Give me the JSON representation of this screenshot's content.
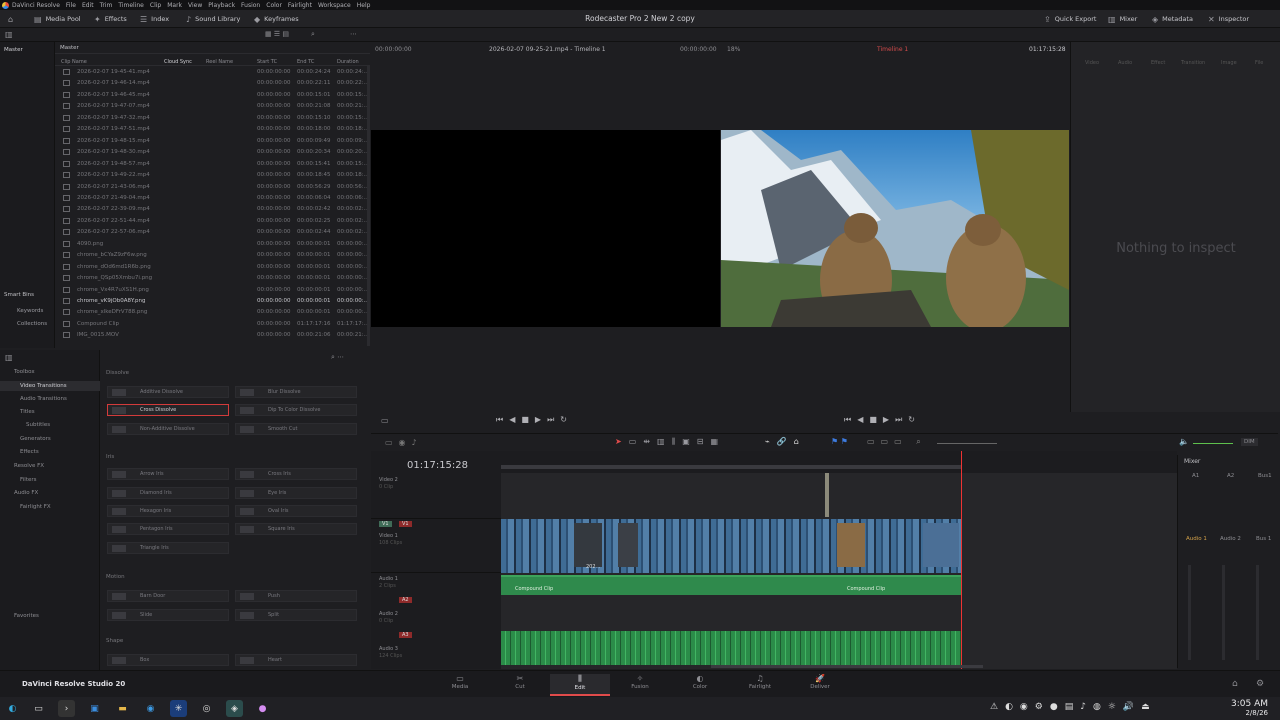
{
  "menu": [
    "DaVinci Resolve",
    "File",
    "Edit",
    "Trim",
    "Timeline",
    "Clip",
    "Mark",
    "View",
    "Playback",
    "Fusion",
    "Color",
    "Fairlight",
    "Workspace",
    "Help"
  ],
  "toolbar": {
    "media_pool": "Media Pool",
    "effects": "Effects",
    "index": "Index",
    "sound_library": "Sound Library",
    "keyframes": "Keyframes",
    "project_title": "Rodecaster Pro 2 New 2 copy",
    "quick_export": "Quick Export",
    "mixer": "Mixer",
    "metadata": "Metadata",
    "inspector": "Inspector"
  },
  "bins": {
    "master": "Master",
    "smart_bins": "Smart Bins",
    "keywords": "Keywords",
    "collections": "Collections"
  },
  "pool": {
    "header": "Master",
    "columns": [
      "Clip Name",
      "Cloud Sync",
      "Reel Name",
      "Start TC",
      "End TC",
      "Duration"
    ],
    "rows": [
      {
        "name": "2026-02-07 19-45-41.mp4",
        "start": "00:00:00:00",
        "end": "00:00:24:24",
        "dur": "00:00:24:..."
      },
      {
        "name": "2026-02-07 19-46-14.mp4",
        "start": "00:00:00:00",
        "end": "00:00:22:11",
        "dur": "00:00:22:..."
      },
      {
        "name": "2026-02-07 19-46-45.mp4",
        "start": "00:00:00:00",
        "end": "00:00:15:01",
        "dur": "00:00:15:..."
      },
      {
        "name": "2026-02-07 19-47-07.mp4",
        "start": "00:00:00:00",
        "end": "00:00:21:08",
        "dur": "00:00:21:..."
      },
      {
        "name": "2026-02-07 19-47-32.mp4",
        "start": "00:00:00:00",
        "end": "00:00:15:10",
        "dur": "00:00:15:..."
      },
      {
        "name": "2026-02-07 19-47-51.mp4",
        "start": "00:00:00:00",
        "end": "00:00:18:00",
        "dur": "00:00:18:..."
      },
      {
        "name": "2026-02-07 19-48-15.mp4",
        "start": "00:00:00:00",
        "end": "00:00:09:49",
        "dur": "00:00:09:..."
      },
      {
        "name": "2026-02-07 19-48-30.mp4",
        "start": "00:00:00:00",
        "end": "00:00:20:34",
        "dur": "00:00:20:..."
      },
      {
        "name": "2026-02-07 19-48-57.mp4",
        "start": "00:00:00:00",
        "end": "00:00:15:41",
        "dur": "00:00:15:..."
      },
      {
        "name": "2026-02-07 19-49-22.mp4",
        "start": "00:00:00:00",
        "end": "00:00:18:45",
        "dur": "00:00:18:..."
      },
      {
        "name": "2026-02-07 21-43-06.mp4",
        "start": "00:00:00:00",
        "end": "00:00:56:29",
        "dur": "00:00:56:..."
      },
      {
        "name": "2026-02-07 21-49-04.mp4",
        "start": "00:00:00:00",
        "end": "00:00:06:04",
        "dur": "00:00:06:..."
      },
      {
        "name": "2026-02-07 22-39-09.mp4",
        "start": "00:00:00:00",
        "end": "00:00:02:42",
        "dur": "00:00:02:..."
      },
      {
        "name": "2026-02-07 22-51-44.mp4",
        "start": "00:00:00:00",
        "end": "00:00:02:25",
        "dur": "00:00:02:..."
      },
      {
        "name": "2026-02-07 22-57-06.mp4",
        "start": "00:00:00:00",
        "end": "00:00:02:44",
        "dur": "00:00:02:..."
      },
      {
        "name": "4090.png",
        "start": "00:00:00:00",
        "end": "00:00:00:01",
        "dur": "00:00:00:..."
      },
      {
        "name": "chrome_bCYaZ9zF6w.png",
        "start": "00:00:00:00",
        "end": "00:00:00:01",
        "dur": "00:00:00:..."
      },
      {
        "name": "chrome_dOd6md1R6b.png",
        "start": "00:00:00:00",
        "end": "00:00:00:01",
        "dur": "00:00:00:..."
      },
      {
        "name": "chrome_QSp05Xmbu7i.png",
        "start": "00:00:00:00",
        "end": "00:00:00:01",
        "dur": "00:00:00:..."
      },
      {
        "name": "chrome_Vx4R7uXS1H.png",
        "start": "00:00:00:00",
        "end": "00:00:00:01",
        "dur": "00:00:00:..."
      },
      {
        "name": "chrome_vK9jOb0A8Y.png",
        "start": "00:00:00:00",
        "end": "00:00:00:01",
        "dur": "00:00:00:..."
      },
      {
        "name": "chrome_xlkeDFrV788.png",
        "start": "00:00:00:00",
        "end": "00:00:00:01",
        "dur": "00:00:00:..."
      },
      {
        "name": "Compound Clip",
        "start": "00:00:00:00",
        "end": "01:17:17:16",
        "dur": "01:17:17:..."
      },
      {
        "name": "IMG_0015.MOV",
        "start": "00:00:00:00",
        "end": "00:00:21:06",
        "dur": "00:00:21:..."
      }
    ]
  },
  "viewer": {
    "src_tc": "00:00:00:00",
    "src_name": "2026-02-07 09-25-21.mp4 - Timeline 1",
    "src_tc2": "00:00:00:00",
    "zoom": "18%",
    "timeline_name": "Timeline 1",
    "prog_tc": "01:17:15:28"
  },
  "inspector": {
    "tabs": [
      "Video",
      "Audio",
      "Effect",
      "Transition",
      "Image",
      "File"
    ],
    "empty": "Nothing to inspect"
  },
  "fx_side": {
    "toolbox": "Toolbox",
    "video_transitions": "Video Transitions",
    "audio_transitions": "Audio Transitions",
    "titles": "Titles",
    "subtitles": "Subtitles",
    "generators": "Generators",
    "effects": "Effects",
    "resolve_fx": "Resolve FX",
    "filters": "Filters",
    "audio_fx": "Audio FX",
    "fairlight_fx": "Fairlight FX",
    "favorites": "Favorites"
  },
  "fx": {
    "dissolve": "Dissolve",
    "iris": "Iris",
    "motion": "Motion",
    "shape": "Shape",
    "t": [
      "Additive Dissolve",
      "Blur Dissolve",
      "Cross Dissolve",
      "Dip To Color Dissolve",
      "Non-Additive Dissolve",
      "Smooth Cut",
      "Arrow Iris",
      "Cross Iris",
      "Diamond Iris",
      "Eye Iris",
      "Hexagon Iris",
      "Oval Iris",
      "Pentagon Iris",
      "Square Iris",
      "Triangle Iris",
      "Barn Door",
      "Push",
      "Slide",
      "Split",
      "Box",
      "Heart"
    ]
  },
  "timeline": {
    "tc": "01:17:15:28",
    "video2": "Video 2",
    "video2_sub": "0 Clip",
    "video1": "Video 1",
    "video1_sub": "108 Clips",
    "audio1": "Audio 1",
    "audio1_sub": "2 Clips",
    "audio2": "Audio 2",
    "audio2_sub": "0 Clip",
    "audio3": "Audio 3",
    "audio3_sub": "124 Clips",
    "compound": "Compound Clip",
    "v1": "V1",
    "a2": "A2",
    "a3": "A3",
    "lvl": "2.0",
    "clip_lbl": "202..."
  },
  "mixer": {
    "title": "Mixer",
    "a1": "A1",
    "a2": "A2",
    "bus1": "Bus1",
    "audio1": "Audio 1",
    "audio2": "Audio 2",
    "bus": "Bus 1",
    "dim": "DIM"
  },
  "pages": [
    "Media",
    "Cut",
    "Edit",
    "Fusion",
    "Color",
    "Fairlight",
    "Deliver"
  ],
  "brand": "DaVinci Resolve Studio 20",
  "clock": {
    "time": "3:05 AM",
    "date": "2/8/26"
  }
}
